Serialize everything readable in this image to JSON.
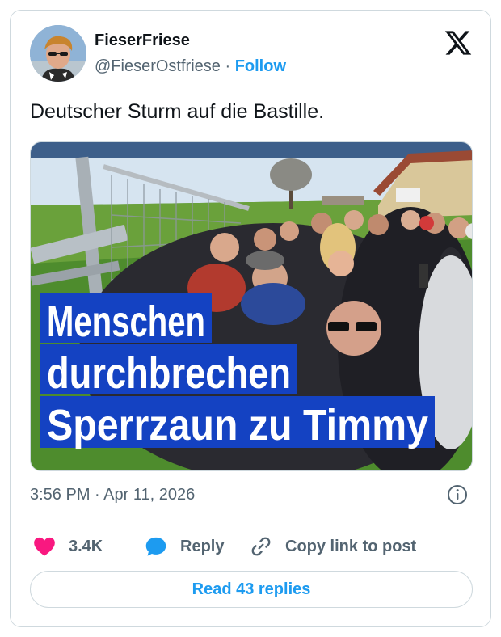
{
  "author": {
    "display_name": "FieserFriese",
    "handle": "@FieserOstfriese",
    "separator": "·",
    "follow_label": "Follow"
  },
  "tweet": {
    "text": "Deutscher Sturm auf die Bastille.",
    "timestamp": "3:56 PM · Apr 11, 2026"
  },
  "media": {
    "headline_lines": [
      "Menschen",
      "durchbrechen",
      "Sperrzaun zu Timmy"
    ]
  },
  "actions": {
    "like_count": "3.4K",
    "reply_label": "Reply",
    "copy_link_label": "Copy link to post"
  },
  "read_replies_label": "Read 43 replies",
  "colors": {
    "accent": "#1d9bf0",
    "like": "#f91880",
    "text": "#0f1419",
    "muted": "#536471",
    "border": "#cfd9de",
    "headline_bg": "#1442c2"
  },
  "icons": {
    "close": "x-logo-icon",
    "info": "info-icon",
    "like": "heart-icon",
    "reply": "speech-bubble-icon",
    "copy": "link-icon"
  }
}
